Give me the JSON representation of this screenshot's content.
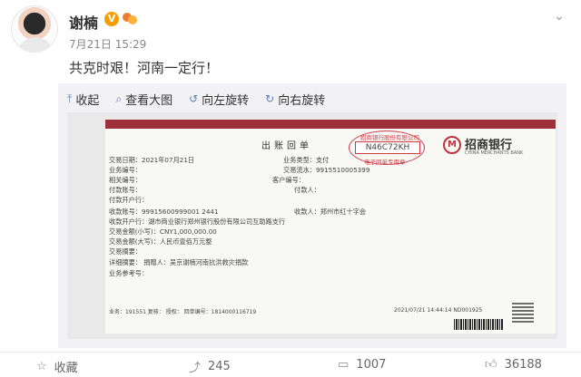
{
  "header": {
    "username": "谢楠",
    "verified_badge": "V",
    "timestamp": "7月21日 15:29",
    "menu_icon": "chevron-down-icon"
  },
  "post": {
    "text": "共克时艰！河南一定行！"
  },
  "media_toolbar": {
    "collapse": "收起",
    "view_large": "查看大图",
    "rotate_left": "向左旋转",
    "rotate_right": "向右旋转"
  },
  "receipt": {
    "title": "出账回单",
    "date": "交易日期：2021年07月21日",
    "business_type": "业务类型：支付",
    "business_no": "业务编号：",
    "txn_serial": "交易流水：9915510005399",
    "related_no": "相关编号：",
    "customer_no": "客户编号：",
    "payer_account": "付款账号：",
    "payer_name": "付款人：",
    "payer_bank": "付款开户行：",
    "payee_account": "收款账号：99915600999001 2441",
    "payee_name": "收款人：郑州市红十字会",
    "payee_bank": "收款开户行：湖市商业银行郑州银行股份有限公司互助路支行",
    "amount_lower": "交易金额(小写)：CNY1,000,000.00",
    "amount_upper": "交易金额(大写)：人民币壹佰万元整",
    "summary": "交易摘要：",
    "detail": "详细摘要：   捐赠人：吴京谢楠河南抗洪救灾捐款",
    "reference": "业务参考号：",
    "footer_left": "业务：191551 复核：   授权：    回单编号：1814000116719",
    "footer_right": "2021/07/21 14:44:14  ND001925",
    "stamp_top": "招商银行股份有限公司",
    "stamp_code": "N46C72KH",
    "stamp_bottom": "电子回单专用章",
    "bank_name": "招商银行",
    "bank_en": "CHINA MERCHANTS BANK",
    "bank_logo": "M",
    "watermark": "@谢楠"
  },
  "actions": {
    "favorite_label": "收藏",
    "repost_count": "245",
    "comment_count": "1007",
    "like_count": "36188"
  },
  "colors": {
    "accent_blue": "#5a7fb5",
    "bank_red": "#9e2f3b",
    "stamp_red": "#cf3a45",
    "badge_orange": "#f59d00"
  }
}
